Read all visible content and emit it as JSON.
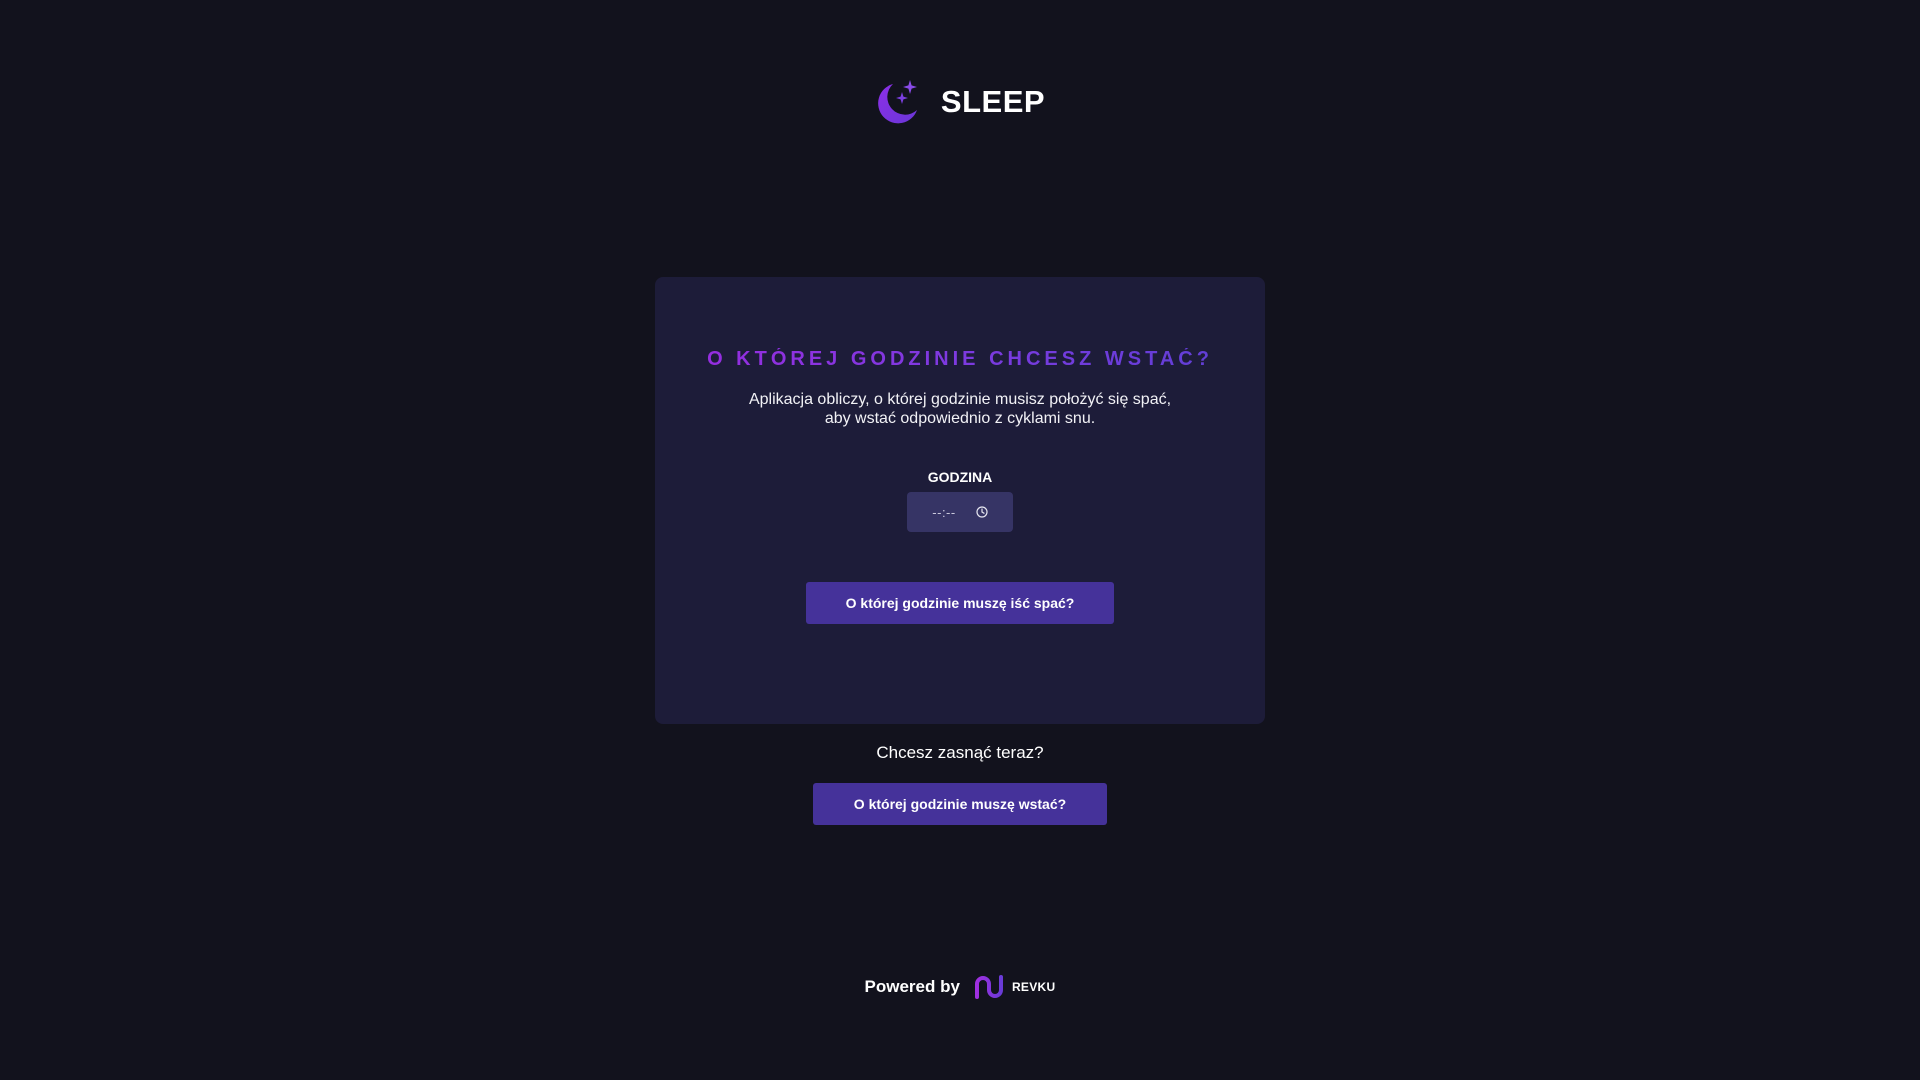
{
  "header": {
    "app_name": "SLEEP",
    "logo_icon": "moon-stars-icon"
  },
  "card": {
    "title": "O KTÓREJ GODZINIE CHCESZ WSTAĆ?",
    "description_line1": "Aplikacja obliczy, o której godzinie musisz położyć się spać,",
    "description_line2": "aby wstać odpowiednio z cyklami snu.",
    "time_field": {
      "label": "GODZINA",
      "value": "--:--",
      "icon": "clock-icon"
    },
    "submit_label": "O której godzinie muszę iść spać?"
  },
  "now": {
    "prompt": "Chcesz zasnąć teraz?",
    "button_label": "O której godzinie muszę wstać?"
  },
  "footer": {
    "powered_by": "Powered by",
    "brand": "REVKU",
    "brand_icon": "revku-logo-icon"
  },
  "colors": {
    "background": "#12121d",
    "card": "#1d1c39",
    "accent": "#45329a",
    "title_gradient_start": "#9a2be0",
    "title_gradient_end": "#5c3fd4"
  }
}
